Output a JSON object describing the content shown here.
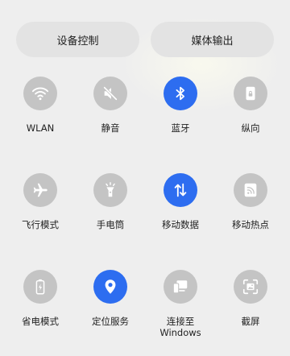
{
  "top_buttons": {
    "device_control": "设备控制",
    "media_output": "媒体输出"
  },
  "tiles": [
    {
      "label": "WLAN",
      "icon": "wifi-icon",
      "active": false
    },
    {
      "label": "静音",
      "icon": "mute-icon",
      "active": false
    },
    {
      "label": "蓝牙",
      "icon": "bluetooth-icon",
      "active": true
    },
    {
      "label": "纵向",
      "icon": "portrait-lock-icon",
      "active": false
    },
    {
      "label": "飞行模式",
      "icon": "airplane-icon",
      "active": false
    },
    {
      "label": "手电筒",
      "icon": "flashlight-icon",
      "active": false
    },
    {
      "label": "移动数据",
      "icon": "mobile-data-icon",
      "active": true
    },
    {
      "label": "移动热点",
      "icon": "hotspot-icon",
      "active": false
    },
    {
      "label": "省电模式",
      "icon": "battery-saver-icon",
      "active": false
    },
    {
      "label": "定位服务",
      "icon": "location-icon",
      "active": true
    },
    {
      "label": "连接至\nWindows",
      "icon": "link-to-windows-icon",
      "active": false
    },
    {
      "label": "截屏",
      "icon": "screenshot-icon",
      "active": false
    }
  ],
  "colors": {
    "active": "#2d6df0",
    "inactive": "#c4c4c4",
    "background": "#eeeeee"
  }
}
